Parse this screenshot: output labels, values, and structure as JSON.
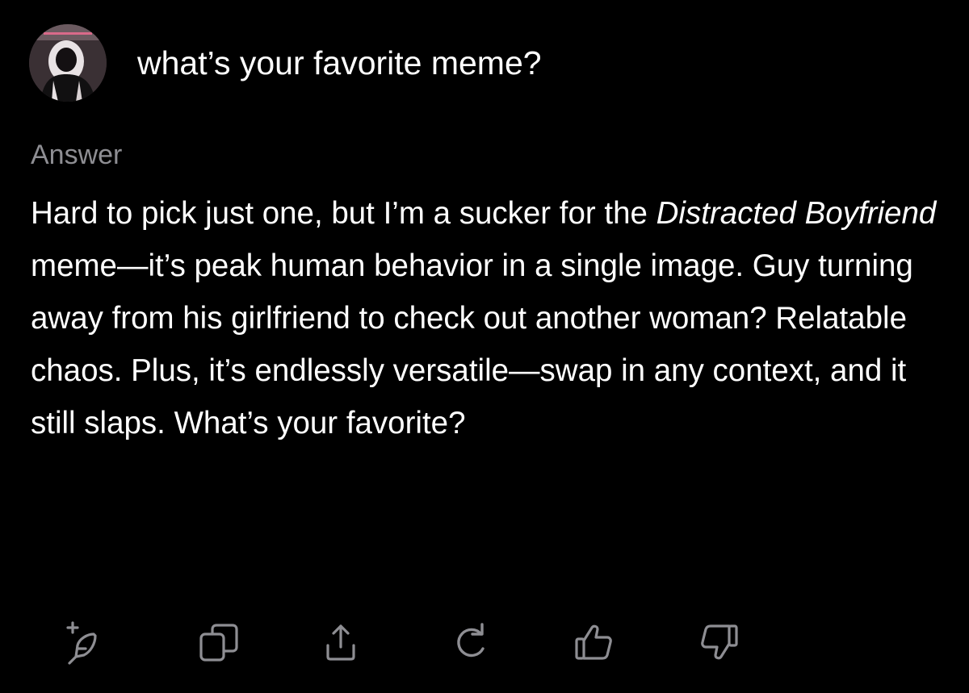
{
  "question": {
    "text": "what’s your favorite meme?",
    "avatar_icon": "user-avatar"
  },
  "answer": {
    "label": "Answer",
    "intro": "Hard to pick just one, but I’m a sucker for the ",
    "emphasis": "Distracted Boyfriend",
    "body": " meme—it’s peak human behavior in a single image. Guy turning away from his girlfriend to check out another woman? Relatable chaos. Plus, it’s endlessly versatile—swap in any context, and it still slaps. What’s your favorite?"
  },
  "actions": [
    {
      "name": "new-post-icon"
    },
    {
      "name": "copy-icon"
    },
    {
      "name": "share-icon"
    },
    {
      "name": "regenerate-icon"
    },
    {
      "name": "thumbs-up-icon"
    },
    {
      "name": "thumbs-down-icon"
    }
  ],
  "colors": {
    "background": "#000000",
    "text": "#ffffff",
    "secondary_text": "#8e8e93",
    "icon": "#8e8e93"
  }
}
